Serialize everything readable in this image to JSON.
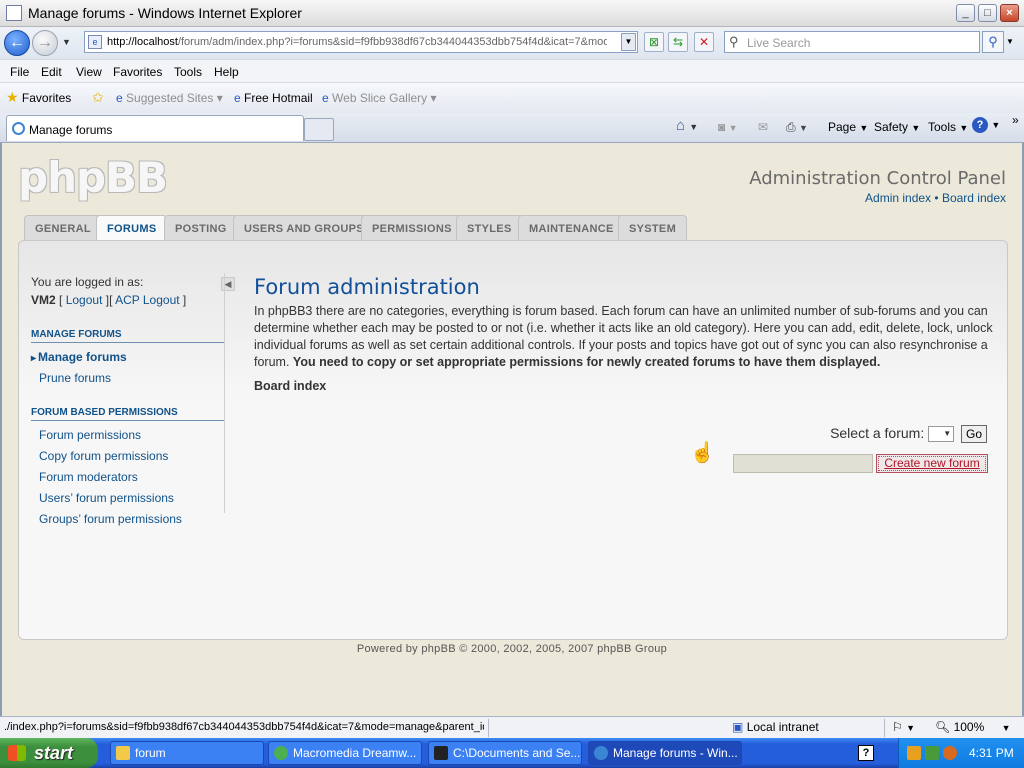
{
  "window": {
    "title": "Manage forums - Windows Internet Explorer"
  },
  "addressbar": {
    "url_host": "http://localhost",
    "url_path": "/forum/adm/index.php?i=forums&sid=f9fbb938df67cb344044353dbb754f4d&icat=7&mode",
    "search_placeholder": "Live Search"
  },
  "menubar": [
    "File",
    "Edit",
    "View",
    "Favorites",
    "Tools",
    "Help"
  ],
  "favbar": {
    "favorites": "Favorites",
    "suggested": "Suggested Sites",
    "hotmail": "Free Hotmail",
    "webslice": "Web Slice Gallery"
  },
  "tab": {
    "label": "Manage forums"
  },
  "commandbar": {
    "page": "Page",
    "safety": "Safety",
    "tools": "Tools"
  },
  "page": {
    "logo": "phpBB",
    "acp_title": "Administration Control Panel",
    "admin_index": "Admin index",
    "board_index_link": "Board index",
    "link_sep": "•",
    "tabs": [
      "General",
      "Forums",
      "Posting",
      "Users and groups",
      "Permissions",
      "Styles",
      "Maintenance",
      "System"
    ],
    "active_tab": "Forums",
    "sidebar": {
      "logged_in": "You are logged in as:",
      "username": "VM2",
      "logout": "Logout",
      "acp_logout": "ACP Logout",
      "section1_title": "Manage forums",
      "section1_items": [
        "Manage forums",
        "Prune forums"
      ],
      "section2_title": "Forum based permissions",
      "section2_items": [
        "Forum permissions",
        "Copy forum permissions",
        "Forum moderators",
        "Users’ forum permissions",
        "Groups’ forum permissions"
      ]
    },
    "main": {
      "heading": "Forum administration",
      "intro": "In phpBB3 there are no categories, everything is forum based. Each forum can have an unlimited number of sub-forums and you can determine whether each may be posted to or not (i.e. whether it acts like an old category). Here you can add, edit, delete, lock, unlock individual forums as well as set certain additional controls. If your posts and topics have got out of sync you can also resynchronise a forum.",
      "intro_bold": "You need to copy or set appropriate permissions for newly created forums to have them displayed.",
      "board_index": "Board index",
      "select_label": "Select a forum:",
      "go_button": "Go",
      "create_button": "Create new forum",
      "new_forum_value": ""
    },
    "footer": "Powered by phpBB © 2000, 2002, 2005, 2007 phpBB Group"
  },
  "statusbar": {
    "url": "./index.php?i=forums&sid=f9fbb938df67cb344044353dbb754f4d&icat=7&mode=manage&parent_id",
    "zone": "Local intranet",
    "zoom": "100%"
  },
  "taskbar": {
    "start": "start",
    "items": [
      "forum",
      "Macromedia Dreamw...",
      "C:\\Documents and Se...",
      "Manage forums - Win..."
    ],
    "clock": "4:31 PM"
  }
}
